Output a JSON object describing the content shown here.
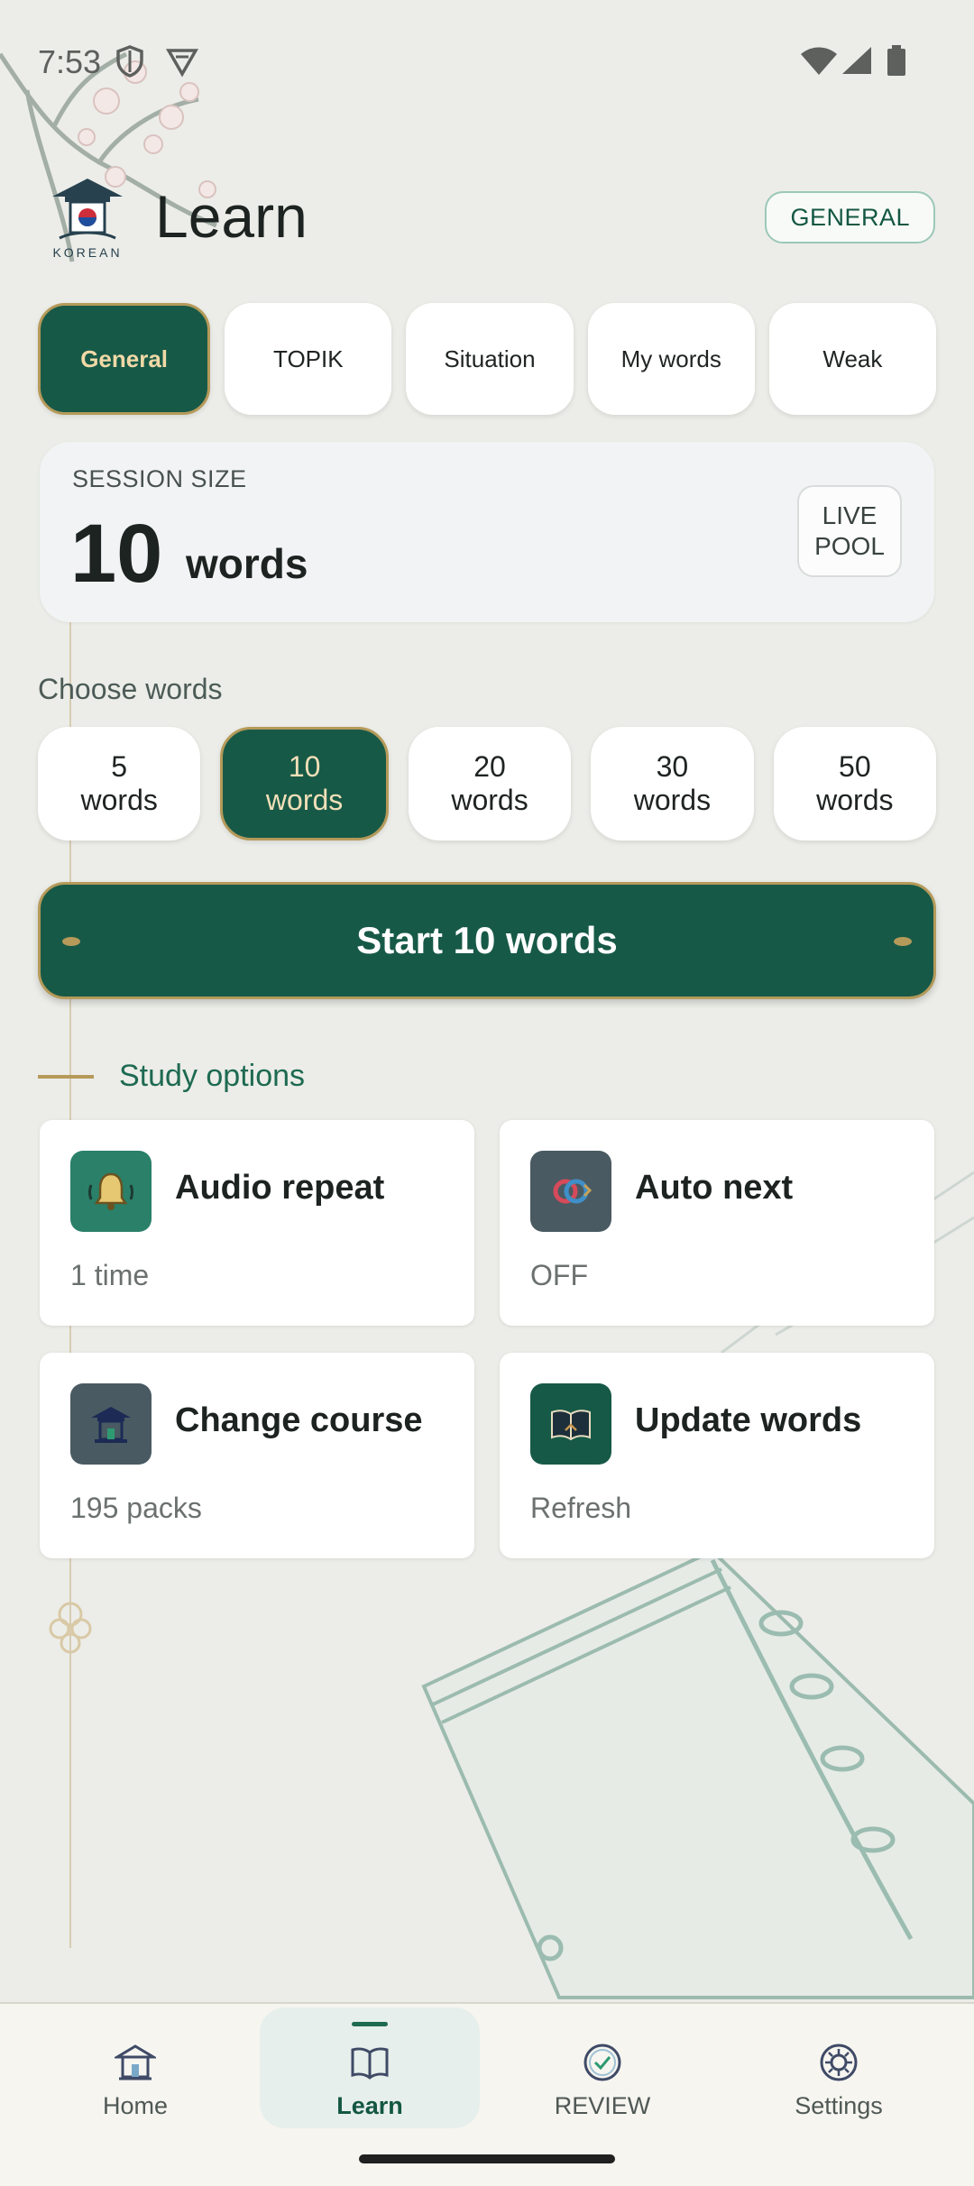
{
  "status_bar": {
    "time": "7:53"
  },
  "header": {
    "logo_text": "KOREAN",
    "title": "Learn",
    "mode_badge": "GENERAL"
  },
  "tabs": [
    {
      "label": "General",
      "active": true
    },
    {
      "label": "TOPIK",
      "active": false
    },
    {
      "label": "Situation",
      "active": false
    },
    {
      "label": "My words",
      "active": false
    },
    {
      "label": "Weak",
      "active": false
    }
  ],
  "session": {
    "label": "SESSION SIZE",
    "count": "10",
    "unit": "words",
    "pool_line1": "LIVE",
    "pool_line2": "POOL"
  },
  "choose_words": {
    "label": "Choose words",
    "options": [
      {
        "number": "5",
        "unit": "words",
        "active": false
      },
      {
        "number": "10",
        "unit": "words",
        "active": true
      },
      {
        "number": "20",
        "unit": "words",
        "active": false
      },
      {
        "number": "30",
        "unit": "words",
        "active": false
      },
      {
        "number": "50",
        "unit": "words",
        "active": false
      }
    ]
  },
  "start_button": {
    "label": "Start 10 words"
  },
  "study_options": {
    "title": "Study options",
    "cards": [
      {
        "title": "Audio repeat",
        "subtitle": "1 time",
        "icon": "bell-icon",
        "color": "#2a8068"
      },
      {
        "title": "Auto next",
        "subtitle": "OFF",
        "icon": "loop-icon",
        "color": "#4a5a62"
      },
      {
        "title": "Change course",
        "subtitle": "195 packs",
        "icon": "pagoda-icon",
        "color": "#4a5a62"
      },
      {
        "title": "Update words",
        "subtitle": "Refresh",
        "icon": "book-icon",
        "color": "#175947"
      }
    ]
  },
  "bottom_nav": [
    {
      "label": "Home",
      "icon": "home-icon",
      "active": false
    },
    {
      "label": "Learn",
      "icon": "book-icon",
      "active": true
    },
    {
      "label": "REVIEW",
      "icon": "check-circle-icon",
      "active": false
    },
    {
      "label": "Settings",
      "icon": "settings-icon",
      "active": false
    }
  ],
  "colors": {
    "primary": "#175947",
    "gold": "#b59a5a",
    "background": "#ecede8"
  }
}
